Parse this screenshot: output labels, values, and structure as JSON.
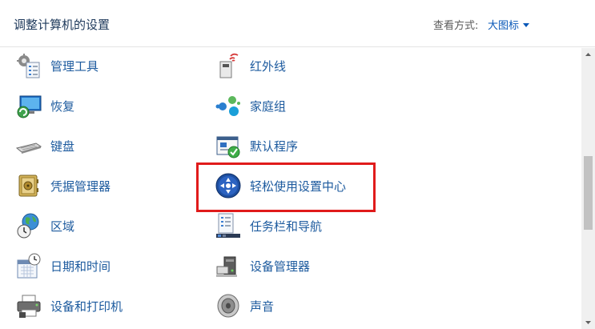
{
  "header": {
    "title": "调整计算机的设置",
    "view_label": "查看方式:",
    "view_value": "大图标"
  },
  "items": {
    "admin_tools": "管理工具",
    "recovery": "恢复",
    "keyboard": "键盘",
    "credential_manager": "凭据管理器",
    "region": "区域",
    "date_time": "日期和时间",
    "devices_printers": "设备和打印机",
    "infrared": "红外线",
    "homegroup": "家庭组",
    "default_programs": "默认程序",
    "ease_of_access": "轻松使用设置中心",
    "taskbar_navigation": "任务栏和导航",
    "device_manager": "设备管理器",
    "sound": "声音"
  },
  "colors": {
    "link": "#1c5a9e",
    "title": "#1e395b",
    "highlight": "#e01b1b"
  }
}
